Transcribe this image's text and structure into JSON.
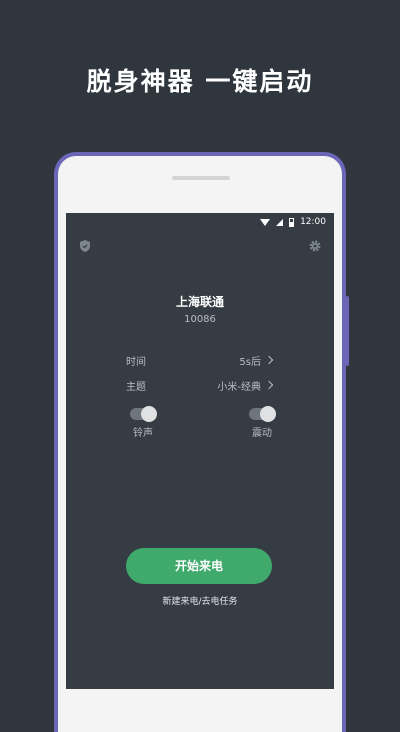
{
  "headline": "脱身神器 一键启动",
  "statusbar": {
    "time": "12:00",
    "icons": [
      "wifi-icon",
      "signal-icon",
      "battery-icon"
    ]
  },
  "topbar": {
    "left_icon": "shield-icon",
    "right_icon": "gear-icon"
  },
  "caller": {
    "name": "上海联通",
    "number": "10086"
  },
  "settings": [
    {
      "label": "时间",
      "value": "5s后"
    },
    {
      "label": "主题",
      "value": "小米-经典"
    }
  ],
  "toggles": [
    {
      "label": "铃声",
      "on": true
    },
    {
      "label": "震动",
      "on": true
    }
  ],
  "start_button": "开始来电",
  "task_link": "新建来电/去电任务",
  "colors": {
    "background": "#2f363e",
    "screen": "#353c44",
    "phone_frame": "#6c66b8",
    "accent_green": "#3faa6b"
  }
}
